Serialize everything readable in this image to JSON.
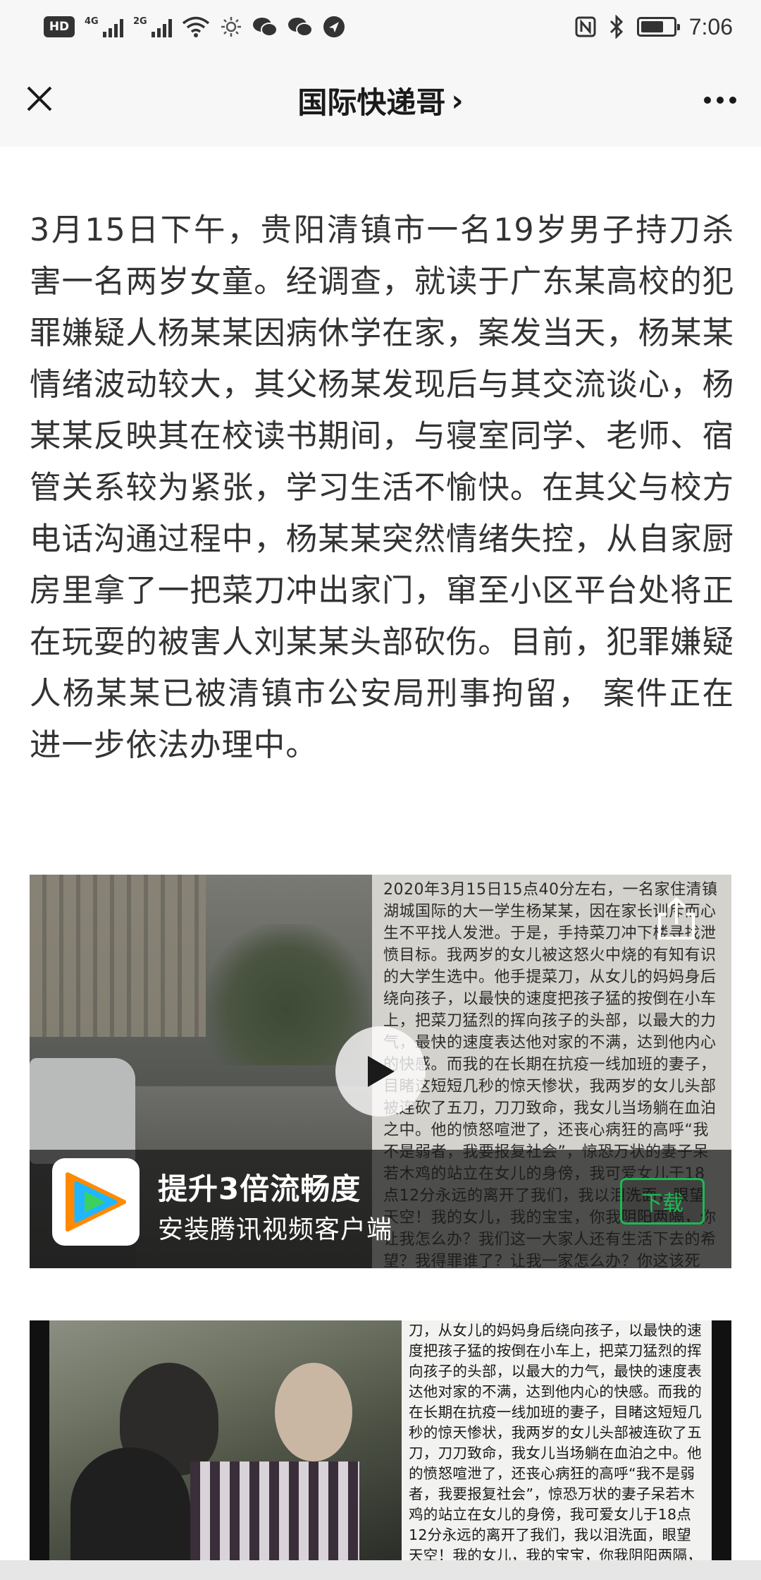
{
  "status_bar": {
    "hd_label": "HD",
    "net1_label": "4G",
    "net2_label": "2G",
    "time": "7:06",
    "battery_level": 0.7
  },
  "nav": {
    "title": "国际快递哥",
    "title_chevron": "›"
  },
  "article": {
    "paragraph": "3月15日下午，贵阳清镇市一名19岁男子持刀杀害一名两岁女童。经调查，就读于广东某高校的犯罪嫌疑人杨某某因病休学在家，案发当天，杨某某情绪波动较大，其父杨某发现后与其交流谈心，杨某某反映其在校读书期间，与寝室同学、老师、宿管关系较为紧张，学习生活不愉快。在其父与校方电话沟通过程中，杨某某突然情绪失控，从自家厨房里拿了一把菜刀冲出家门，窜至小区平台处将正在玩耍的被害人刘某某头部砍伤。目前，犯罪嫌疑人杨某某已被清镇市公安局刑事拘留， 案件正在进一步依法办理中。"
  },
  "video": {
    "overlay_text": "2020年3月15日15点40分左右，一名家住清镇湖城国际的大一学生杨某某，因在家长训斥而心生不平找人发泄。于是，手持菜刀冲下楼寻找泄愤目标。我两岁的女儿被这怒火中烧的有知有识的大学生选中。他手提菜刀，从女儿的妈妈身后绕向孩子，以最快的速度把孩子猛的按倒在小车上，把菜刀猛烈的挥向孩子的头部，以最大的力气，最快的速度表达他对家的不满，达到他内心的快感。而我的在长期在抗疫一线加班的妻子，目睹这短短几秒的惊天惨状，我两岁的女儿头部被连砍了五刀，刀刀致命，我女儿当场躺在血泊之中。他的愤怒喧泄了，还丧心病狂的高呼“我不是弱者，我要报复社会”，惊恐万状的妻子呆若木鸡的站立在女儿的身傍，我可爱女儿于18点12分永远的离开了我们，我以泪洗面，眼望天空！我的女儿，我的宝宝，你我阴阳两隔，你让我怎么办？我们这一大家人还有生活下去的希望？我得罪谁了？让我一家怎么办？你这该死的，你家中的事",
    "promo_title": "提升3倍流畅度",
    "promo_subtitle": "安装腾讯视频客户端",
    "download_label": "下载",
    "accent_color": "#1db954"
  },
  "image2": {
    "overlay_text": "刀，从女儿的妈妈身后绕向孩子，以最快的速度把孩子猛的按倒在小车上，把菜刀猛烈的挥向孩子的头部，以最大的力气，最快的速度表达他对家的不满，达到他内心的快感。而我的在长期在抗疫一线加班的妻子，目睹这短短几秒的惊天惨状，我两岁的女儿头部被连砍了五刀，刀刀致命，我女儿当场躺在血泊之中。他的愤怒喧泄了，还丧心病狂的高呼“我不是弱者，我要报复社会”，惊恐万状的妻子呆若木鸡的站立在女儿的身傍，我可爱女儿于18点12分永远的离开了我们，我以泪洗面，眼望天空！我的女儿，我的宝宝，你我阴阳两隔，你让我怎么办？我们这一大家人还有生活下去的希望？"
  },
  "icons": {
    "close": "close-icon",
    "more": "more-icon",
    "play": "play-icon",
    "share": "share-icon",
    "app": "tencent-video-logo"
  }
}
